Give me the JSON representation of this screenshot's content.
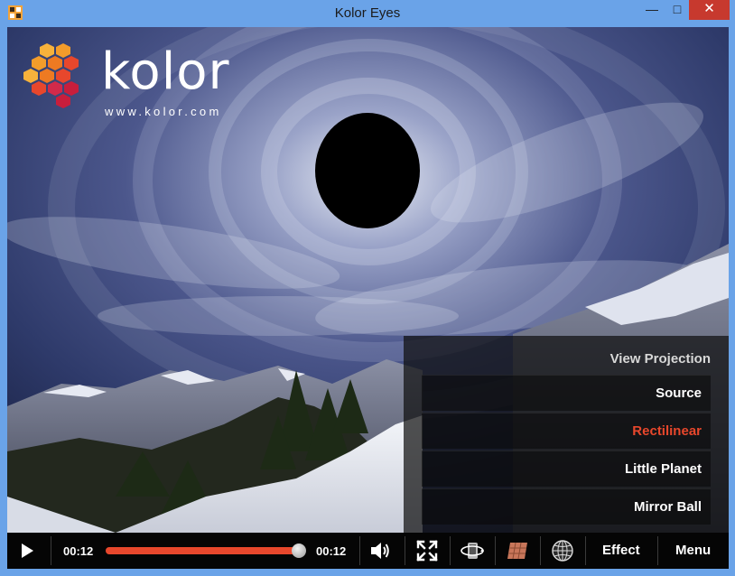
{
  "window": {
    "title": "Kolor Eyes",
    "minimize_glyph": "—",
    "maximize_glyph": "□",
    "close_glyph": "✕"
  },
  "logo": {
    "wordmark": "kolor",
    "url": "www.kolor.com"
  },
  "projection_menu": {
    "title": "View Projection",
    "items": [
      {
        "label": "Source",
        "selected": false
      },
      {
        "label": "Rectilinear",
        "selected": true
      },
      {
        "label": "Little Planet",
        "selected": false
      },
      {
        "label": "Mirror Ball",
        "selected": false
      }
    ]
  },
  "player": {
    "current_time": "00:12",
    "total_time": "00:12",
    "progress": 1.0,
    "effect_label": "Effect",
    "menu_label": "Menu"
  },
  "icons": {
    "play": "play-icon",
    "volume": "volume-icon",
    "fullscreen": "fullscreen-icon",
    "gyro": "gyroscope-icon",
    "texture": "texture-icon",
    "globe": "globe-icon"
  },
  "colors": {
    "accent": "#e8472c",
    "titlebar": "#6aa3e8",
    "close": "#c7392e"
  }
}
